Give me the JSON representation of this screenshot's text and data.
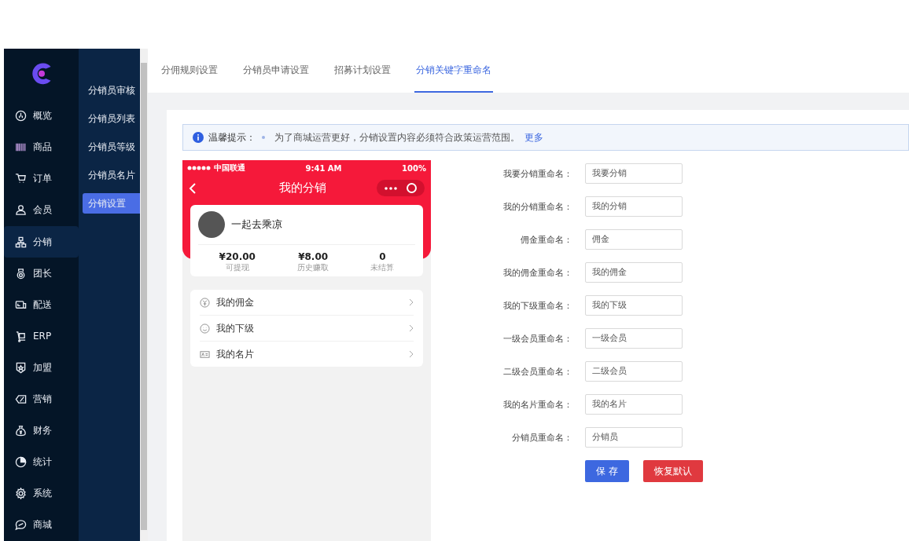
{
  "sidebar": {
    "items": [
      {
        "label": "概览",
        "selected": false
      },
      {
        "label": "商品",
        "selected": false
      },
      {
        "label": "订单",
        "selected": false
      },
      {
        "label": "会员",
        "selected": false
      },
      {
        "label": "分销",
        "selected": true
      },
      {
        "label": "团长",
        "selected": false
      },
      {
        "label": "配送",
        "selected": false
      },
      {
        "label": "ERP",
        "selected": false
      },
      {
        "label": "加盟",
        "selected": false
      },
      {
        "label": "营销",
        "selected": false
      },
      {
        "label": "财务",
        "selected": false
      },
      {
        "label": "统计",
        "selected": false
      },
      {
        "label": "系统",
        "selected": false
      },
      {
        "label": "商城",
        "selected": false
      }
    ]
  },
  "submenu": {
    "items": [
      {
        "label": "分销员审核",
        "selected": false
      },
      {
        "label": "分销员列表",
        "selected": false
      },
      {
        "label": "分销员等级",
        "selected": false
      },
      {
        "label": "分销员名片",
        "selected": false
      },
      {
        "label": "分销设置",
        "selected": true
      }
    ]
  },
  "tabs": [
    {
      "label": "分佣规则设置",
      "selected": false
    },
    {
      "label": "分销员申请设置",
      "selected": false
    },
    {
      "label": "招募计划设置",
      "selected": false
    },
    {
      "label": "分销关键字重命名",
      "selected": true
    }
  ],
  "notice": {
    "title": "温馨提示：",
    "text": "为了商城运营更好，分销设置内容必须符合政策运营范围。",
    "link": "更多"
  },
  "phone": {
    "status": {
      "carrier": "中国联通",
      "time": "9:41 AM",
      "battery": "100%"
    },
    "title": "我的分销",
    "user": "一起去乘凉",
    "stats": [
      {
        "value": "¥20.00",
        "label": "可提现"
      },
      {
        "value": "¥8.00",
        "label": "历史赚取"
      },
      {
        "value": "0",
        "label": "未结算"
      }
    ],
    "menu": [
      {
        "label": "我的佣金"
      },
      {
        "label": "我的下级"
      },
      {
        "label": "我的名片"
      }
    ]
  },
  "form": {
    "fields": [
      {
        "label": "我要分销重命名：",
        "value": "我要分销"
      },
      {
        "label": "我的分销重命名：",
        "value": "我的分销"
      },
      {
        "label": "佣金重命名：",
        "value": "佣金"
      },
      {
        "label": "我的佣金重命名：",
        "value": "我的佣金"
      },
      {
        "label": "我的下级重命名：",
        "value": "我的下级"
      },
      {
        "label": "一级会员重命名：",
        "value": "一级会员"
      },
      {
        "label": "二级会员重命名：",
        "value": "二级会员"
      },
      {
        "label": "我的名片重命名：",
        "value": "我的名片"
      },
      {
        "label": "分销员重命名：",
        "value": "分销员"
      }
    ],
    "buttons": [
      {
        "label": "保 存",
        "kind": "primary"
      },
      {
        "label": "恢复默认",
        "kind": "danger"
      }
    ]
  }
}
